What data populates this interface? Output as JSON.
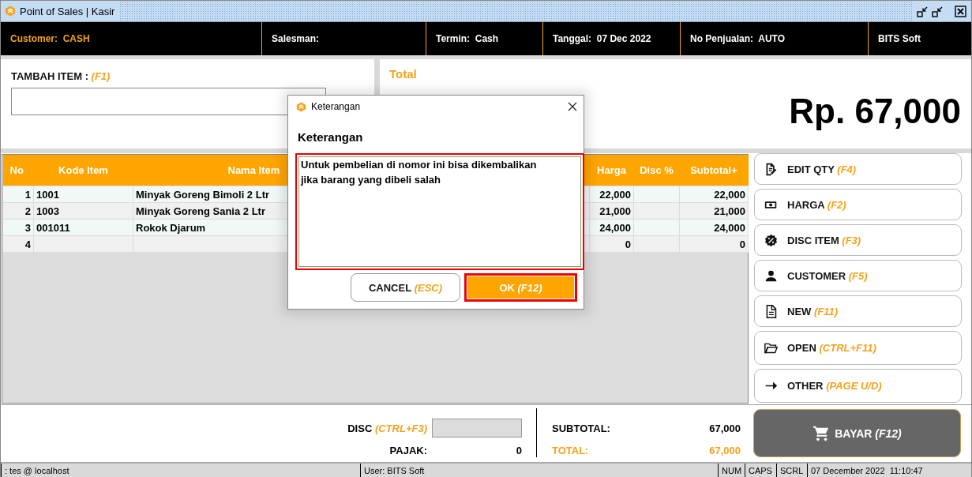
{
  "window": {
    "title": "Point of Sales | Kasir"
  },
  "info_bar": [
    {
      "label": "Customer:",
      "value": "CASH",
      "highlight": true
    },
    {
      "label": "Salesman:",
      "highlight": false
    },
    {
      "label": "Termin:",
      "value": "Cash",
      "highlight": false
    },
    {
      "label": "Tanggal:",
      "value": "07 Dec 2022",
      "highlight": false
    },
    {
      "label": "No Penjualan:",
      "value": "AUTO",
      "highlight": false
    },
    {
      "label": "BITS Soft",
      "highlight": false
    }
  ],
  "add_item": {
    "label": "TAMBAH ITEM :",
    "shortcut": "(F1)"
  },
  "total": {
    "label": "Total",
    "amount": "Rp. 67,000"
  },
  "table": {
    "columns": [
      "No",
      "Kode Item",
      "Nama Item",
      "Harga",
      "Disc %",
      "Subtotal+"
    ],
    "rows": [
      {
        "no": "1",
        "code": "1001",
        "name": "Minyak Goreng Bimoli 2 Ltr",
        "price": "22,000",
        "subtotal": "22,000"
      },
      {
        "no": "2",
        "code": "1003",
        "name": "Minyak Goreng Sania 2 Ltr",
        "price": "21,000",
        "subtotal": "21,000"
      },
      {
        "no": "3",
        "code": "001011",
        "name": "Rokok Djarum",
        "price": "24,000",
        "subtotal": "24,000"
      },
      {
        "no": "4",
        "price": "0",
        "subtotal": "0"
      }
    ]
  },
  "actions": [
    {
      "kind": "edit",
      "label": "EDIT QTY",
      "shortcut": "(F4)"
    },
    {
      "kind": "money",
      "label": "HARGA",
      "shortcut": "(F2)"
    },
    {
      "kind": "discount",
      "label": "DISC ITEM",
      "shortcut": "(F3)"
    },
    {
      "kind": "person",
      "label": "CUSTOMER",
      "shortcut": "(F5)"
    },
    {
      "kind": "document",
      "label": "NEW",
      "shortcut": "(F11)"
    },
    {
      "kind": "folder",
      "label": "OPEN",
      "shortcut": "(CTRL+F11)"
    },
    {
      "kind": "arrow",
      "label": "OTHER",
      "shortcut": "(PAGE U/D)"
    }
  ],
  "summary": {
    "disc": {
      "label": "DISC",
      "shortcut": "(CTRL+F3)"
    },
    "tax": {
      "label": "PAJAK:",
      "value": "0"
    },
    "subtotal": {
      "label": "SUBTOTAL:",
      "value": "67,000"
    },
    "total": {
      "label": "TOTAL:",
      "value": "67,000"
    }
  },
  "pay_button": {
    "label": "BAYAR",
    "shortcut": "(F12)"
  },
  "status_bar": [
    ": tes @ localhost",
    "User: BITS Soft",
    "NUM",
    "CAPS",
    "SCRL",
    "07 December 2022  11:10:47"
  ],
  "dialog": {
    "title": "Keterangan",
    "label": "Keterangan",
    "text": "Untuk pembelian di nomor ini bisa dikembalikan jika barang yang dibeli salah",
    "buttons": [
      {
        "kind": "secondary",
        "label": "CANCEL",
        "shortcut": "(ESC)"
      },
      {
        "kind": "primary",
        "label": "OK",
        "shortcut": "(F12)"
      }
    ]
  }
}
